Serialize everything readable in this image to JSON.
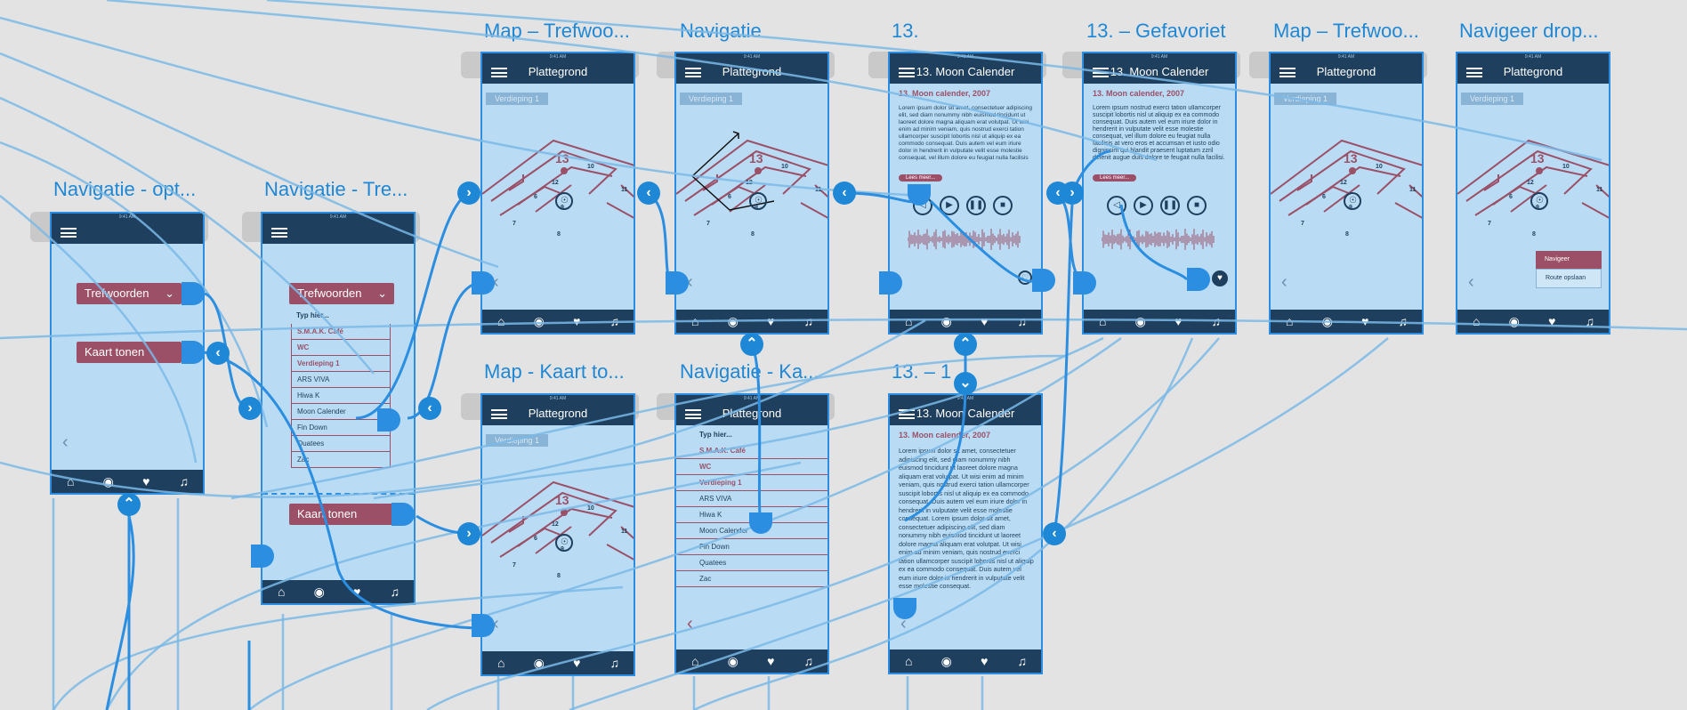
{
  "labels": {
    "nav_opt": "Navigatie - opt...",
    "nav_tre": "Navigatie - Tre...",
    "map_tref1": "Map – Trefwoo...",
    "navigatie": "Navigatie",
    "n13": "13.",
    "n13_fav": "13. – Gefavoriet",
    "map_tref2": "Map – Trefwoo...",
    "nav_drop": "Navigeer drop...",
    "map_kaart": "Map - Kaart to...",
    "nav_ka": "Navigatie - Ka...",
    "n13_1": "13. – 1"
  },
  "common": {
    "status": "9:41 AM",
    "battery": "100%",
    "plattegrond": "Plattegrond",
    "moon_title": "13. Moon Calender",
    "verdieping": "Verdieping 1",
    "tab_home": "⌂",
    "tab_user": "◉",
    "tab_heart": "♥",
    "tab_music": "♫",
    "back": "‹"
  },
  "opt": {
    "trefwoorden": "Trefwoorden",
    "kaart_tonen": "Kaart tonen"
  },
  "list": {
    "head": "Typ hier...",
    "items": [
      "S.M.A.K. Café",
      "WC",
      "Verdieping 1",
      "ARS VIVA",
      "Hiwa K",
      "Moon Calender",
      "Fin Down",
      "Quatees",
      "Zac"
    ]
  },
  "article": {
    "title": "13. Moon calender, 2007",
    "lorem1": "Lorem ipsum dolor sit amet, consectetuer adipiscing elit, sed diam nonummy nibh euismod tincidunt ut laoreet dolore magna aliquam erat volutpat. Ut wisi enim ad minim veniam, quis nostrud exerci tation ullamcorper suscipit lobortis nisl ut aliquip ex ea commodo consequat. Duis autem vel eum iriure dolor in hendrerit in vulputate velit esse molestie consequat, vel illum dolore eu feugiat nulla facilisis at vero eros et accumsan et iusto odio dignissim qui blandit praesent luptatum zzril delenit",
    "lorem2": "Lorem ipsum nostrud exerci tation ullamcorper suscipit lobortis nisl ut aliquip ex ea commodo consequat. Duis autem vel eum iriure dolor in hendrerit in vulputate velit esse molestie consequat, vel illum dolore eu feugiat nulla facilisis at vero eros et accumsan et iusto odio dignissim qui blandit praesent luptatum zzril delenit augue duis dolore te feugait nulla facilisi.",
    "lorem3": "Lorem ipsum dolor sit amet, consectetuer adipiscing elit, sed diam nonummy nibh euismod tincidunt ut laoreet dolore magna aliquam erat volutpat. Ut wisi enim ad minim veniam, quis nostrud exerci tation ullamcorper suscipit lobortis nisl ut aliquip ex ea commodo consequat. Duis autem vel eum iriure dolor in hendrerit in vulputate velit esse molestie consequat. Lorem ipsum dolor sit amet, consectetuer adipiscing elit, sed diam nonummy nibh euismod tincidunt ut laoreet dolore magna aliquam erat volutpat. Ut wisi enim ad minim veniam, quis nostrud exerci tation ullamcorper suscipit lobortis nisl ut aliquip ex ea commodo consequat. Duis autem vel eum iriure dolor in hendrerit in vulputate velit esse molestie consequat.",
    "lees_meer": "Lees meer..."
  },
  "map_numbers": [
    "13",
    "10",
    "12",
    "6",
    "9",
    "11",
    "7",
    "8"
  ],
  "dropdown": {
    "navigeer": "Navigeer",
    "route": "Route opslaan"
  },
  "colors": {
    "wire": "#2b8ee0",
    "wire_light": "#7ab8e6",
    "accent": "#9b5068",
    "frame_bg": "#b9dcf4",
    "nav_bg": "#1f3f5e"
  }
}
